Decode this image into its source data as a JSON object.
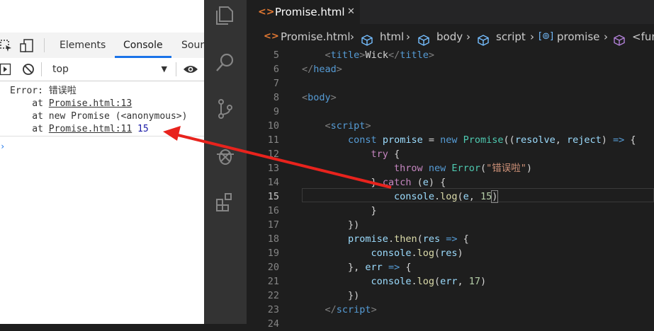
{
  "devtools": {
    "tabs": [
      "Elements",
      "Console",
      "Sour"
    ],
    "active_tab": "Console",
    "context": "top",
    "console": {
      "error_label": "Error: 错误啦",
      "at1_prefix": "    at ",
      "at1_link": "Promise.html:13",
      "at2": "    at new Promise (<anonymous>)",
      "at3_prefix": "    at ",
      "at3_link": "Promise.html:11",
      "logged_value": "15"
    }
  },
  "vscode": {
    "tab": {
      "label": "Promise.html",
      "close": "✕",
      "icon": "html-file-icon"
    },
    "breadcrumbs": [
      "Promise.html",
      "html",
      "body",
      "script",
      "promise",
      "<fur"
    ],
    "lines": [
      {
        "n": "5",
        "cur": false
      },
      {
        "n": "6",
        "cur": false
      },
      {
        "n": "7",
        "cur": false
      },
      {
        "n": "8",
        "cur": false
      },
      {
        "n": "9",
        "cur": false
      },
      {
        "n": "10",
        "cur": false
      },
      {
        "n": "11",
        "cur": false
      },
      {
        "n": "12",
        "cur": false
      },
      {
        "n": "13",
        "cur": false
      },
      {
        "n": "14",
        "cur": false
      },
      {
        "n": "15",
        "cur": true
      },
      {
        "n": "16",
        "cur": false
      },
      {
        "n": "17",
        "cur": false
      },
      {
        "n": "18",
        "cur": false
      },
      {
        "n": "19",
        "cur": false
      },
      {
        "n": "20",
        "cur": false
      },
      {
        "n": "21",
        "cur": false
      },
      {
        "n": "22",
        "cur": false
      },
      {
        "n": "23",
        "cur": false
      },
      {
        "n": "24",
        "cur": false
      }
    ],
    "code": {
      "l5": [
        "    ",
        "<",
        "title",
        ">",
        "Wick",
        "</",
        "title",
        ">"
      ],
      "l6": [
        "",
        "</",
        "head",
        ">"
      ],
      "l8": [
        "",
        "<",
        "body",
        ">"
      ],
      "l10": [
        "    ",
        "<",
        "script",
        ">"
      ],
      "l11": [
        "        ",
        "const",
        " ",
        "promise",
        " = ",
        "new",
        " ",
        "Promise",
        "((",
        "resolve",
        ", ",
        "reject",
        ") ",
        "=>",
        " {"
      ],
      "l12": [
        "            ",
        "try",
        " {"
      ],
      "l13": [
        "                ",
        "throw",
        " ",
        "new",
        " ",
        "Error",
        "(",
        "\"错误啦\"",
        ")"
      ],
      "l14": [
        "            ",
        "}",
        " ",
        "catch",
        " (",
        "e",
        ") {"
      ],
      "l15": [
        "                ",
        "console",
        ".",
        "log",
        "(",
        "e",
        ", ",
        "15",
        ")"
      ],
      "l16": [
        "            ",
        "}"
      ],
      "l17": [
        "        ",
        "})"
      ],
      "l18": [
        "        ",
        "promise",
        ".",
        "then",
        "(",
        "res",
        " ",
        "=>",
        " {"
      ],
      "l19": [
        "            ",
        "console",
        ".",
        "log",
        "(",
        "res",
        ")"
      ],
      "l20": [
        "        ",
        "}, ",
        "err",
        " ",
        "=>",
        " {"
      ],
      "l21": [
        "            ",
        "console",
        ".",
        "log",
        "(",
        "err",
        ", ",
        "17",
        ")"
      ],
      "l22": [
        "        ",
        "})"
      ],
      "l23": [
        "    ",
        "</",
        "script",
        ">"
      ]
    }
  },
  "annotation": {
    "color": "#e8231d"
  }
}
